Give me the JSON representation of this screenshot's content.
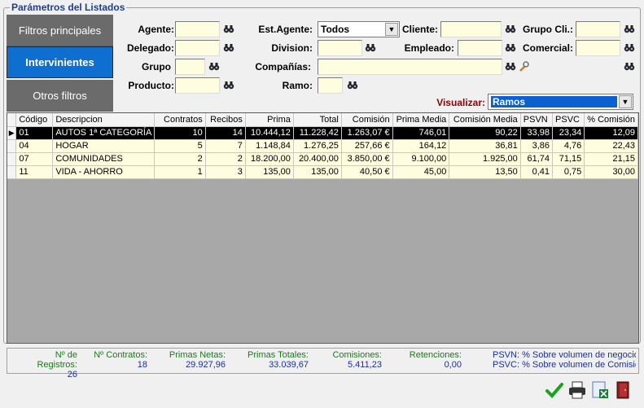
{
  "group_title": "Parámetros del Listados",
  "tabs": [
    {
      "label": "Filtros principales",
      "active": false
    },
    {
      "label": "Intervinientes",
      "active": true
    },
    {
      "label": "Otros filtros",
      "active": false
    }
  ],
  "filters": {
    "agente": {
      "label": "Agente:",
      "value": ""
    },
    "delegado": {
      "label": "Delegado:",
      "value": ""
    },
    "grupo": {
      "label": "Grupo",
      "value": ""
    },
    "producto": {
      "label": "Producto:",
      "value": ""
    },
    "est_agente": {
      "label": "Est.Agente:",
      "value": "Todos"
    },
    "division": {
      "label": "Division:",
      "value": ""
    },
    "companias": {
      "label": "Compañías:",
      "value": ""
    },
    "ramo": {
      "label": "Ramo:",
      "value": ""
    },
    "cliente": {
      "label": "Cliente:",
      "value": ""
    },
    "empleado": {
      "label": "Empleado:",
      "value": ""
    },
    "grupo_cli": {
      "label": "Grupo Cli.:",
      "value": ""
    },
    "comercial": {
      "label": "Comercial:",
      "value": ""
    },
    "visualizar": {
      "label": "Visualizar:",
      "value": "Ramos"
    }
  },
  "table": {
    "headers": [
      "Código",
      "Descripcion",
      "Contratos",
      "Recibos",
      "Prima",
      "Total",
      "Comisión",
      "Prima Media",
      "Comisión Media",
      "PSVN",
      "PSVC",
      "% Comisión"
    ],
    "rows": [
      [
        "01",
        "AUTOS 1ª CATEGORÍA",
        "10",
        "14",
        "10.444,12",
        "11.228,42",
        "1.263,07 €",
        "746,01",
        "90,22",
        "33,98",
        "23,34",
        "12,09"
      ],
      [
        "04",
        "HOGAR",
        "5",
        "7",
        "1.148,84",
        "1.276,25",
        "257,66 €",
        "164,12",
        "36,81",
        "3,86",
        "4,76",
        "22,43"
      ],
      [
        "07",
        "COMUNIDADES",
        "2",
        "2",
        "18.200,00",
        "20.400,00",
        "3.850,00 €",
        "9.100,00",
        "1.925,00",
        "61,74",
        "71,15",
        "21,15"
      ],
      [
        "11",
        "VIDA - AHORRO",
        "1",
        "3",
        "135,00",
        "135,00",
        "40,50 €",
        "45,00",
        "13,50",
        "0,41",
        "0,75",
        "30,00"
      ]
    ]
  },
  "summary": {
    "registros": {
      "label": "Nº de Registros:",
      "value": "26"
    },
    "contratos": {
      "label": "Nº Contratos:",
      "value": "18"
    },
    "primas_netas": {
      "label": "Primas Netas:",
      "value": "29.927,96"
    },
    "primas_totales": {
      "label": "Primas Totales:",
      "value": "33.039,67"
    },
    "comisiones": {
      "label": "Comisiones:",
      "value": "5.411,23"
    },
    "retenciones": {
      "label": "Retenciones:",
      "value": "0,00"
    },
    "psvn_legend": "PSVN: % Sobre volumen de negocio",
    "psvc_legend": "PSVC: % Sobre volumen de Comisión"
  },
  "colors": {
    "accent": "#0f6fd1",
    "input_bg": "#fffde0",
    "label_green": "#1a7a1a",
    "value_blue": "#1a2fa0"
  }
}
